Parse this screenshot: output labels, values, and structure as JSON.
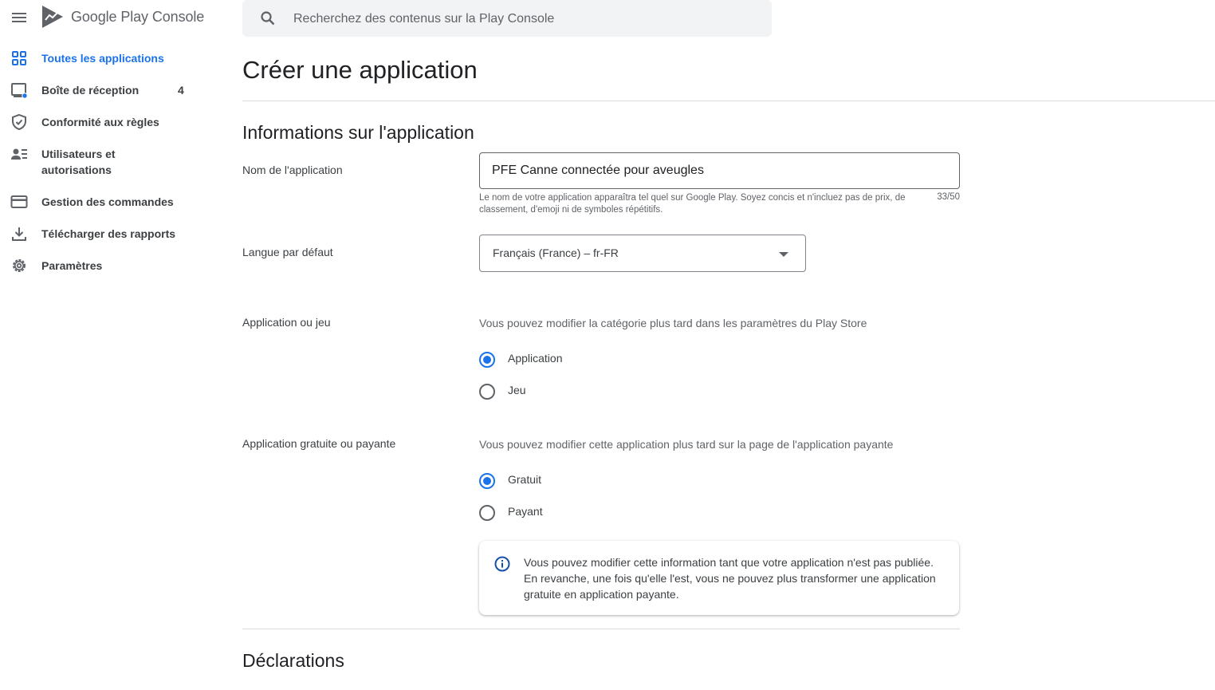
{
  "app": {
    "brand": "Google Play Console"
  },
  "sidebar": {
    "items": [
      {
        "label": "Toutes les applications",
        "icon": "grid-icon",
        "active": true
      },
      {
        "label": "Boîte de réception",
        "icon": "inbox-icon",
        "badge": "4"
      },
      {
        "label": "Conformité aux règles",
        "icon": "shield-check-icon"
      },
      {
        "label": "Utilisateurs et autorisations",
        "icon": "people-icon"
      },
      {
        "label": "Gestion des commandes",
        "icon": "credit-card-icon"
      },
      {
        "label": "Télécharger des rapports",
        "icon": "download-icon"
      },
      {
        "label": "Paramètres",
        "icon": "gear-icon"
      }
    ],
    "users_line1": "Utilisateurs et",
    "users_line2": "autorisations"
  },
  "search": {
    "placeholder": "Recherchez des contenus sur la Play Console"
  },
  "page": {
    "title": "Créer une application"
  },
  "app_info": {
    "section_title": "Informations sur l'application",
    "name_label": "Nom de l'application",
    "name_value": "PFE Canne connectée pour aveugles",
    "name_helper": "Le nom de votre application apparaîtra tel quel sur Google Play. Soyez concis et n'incluez pas de prix, de classement, d'emoji ni de symboles répétitifs.",
    "name_counter": "33/50",
    "language_label": "Langue par défaut",
    "language_value": "Français (France) – fr-FR",
    "type_label": "Application ou jeu",
    "type_desc": "Vous pouvez modifier la catégorie plus tard dans les paramètres du Play Store",
    "type_options": [
      "Application",
      "Jeu"
    ],
    "type_selected": "Application",
    "price_label": "Application gratuite ou payante",
    "price_desc": "Vous pouvez modifier cette application plus tard sur la page de l'application payante",
    "price_options": [
      "Gratuit",
      "Payant"
    ],
    "price_selected": "Gratuit",
    "info_note": "Vous pouvez modifier cette information tant que votre application n'est pas publiée. En revanche, une fois qu'elle l'est, vous ne pouvez plus transformer une application gratuite en application payante."
  },
  "declarations": {
    "section_title": "Déclarations"
  },
  "colors": {
    "accent": "#1a73e8",
    "text": "#202124",
    "secondary": "#5f6368"
  }
}
